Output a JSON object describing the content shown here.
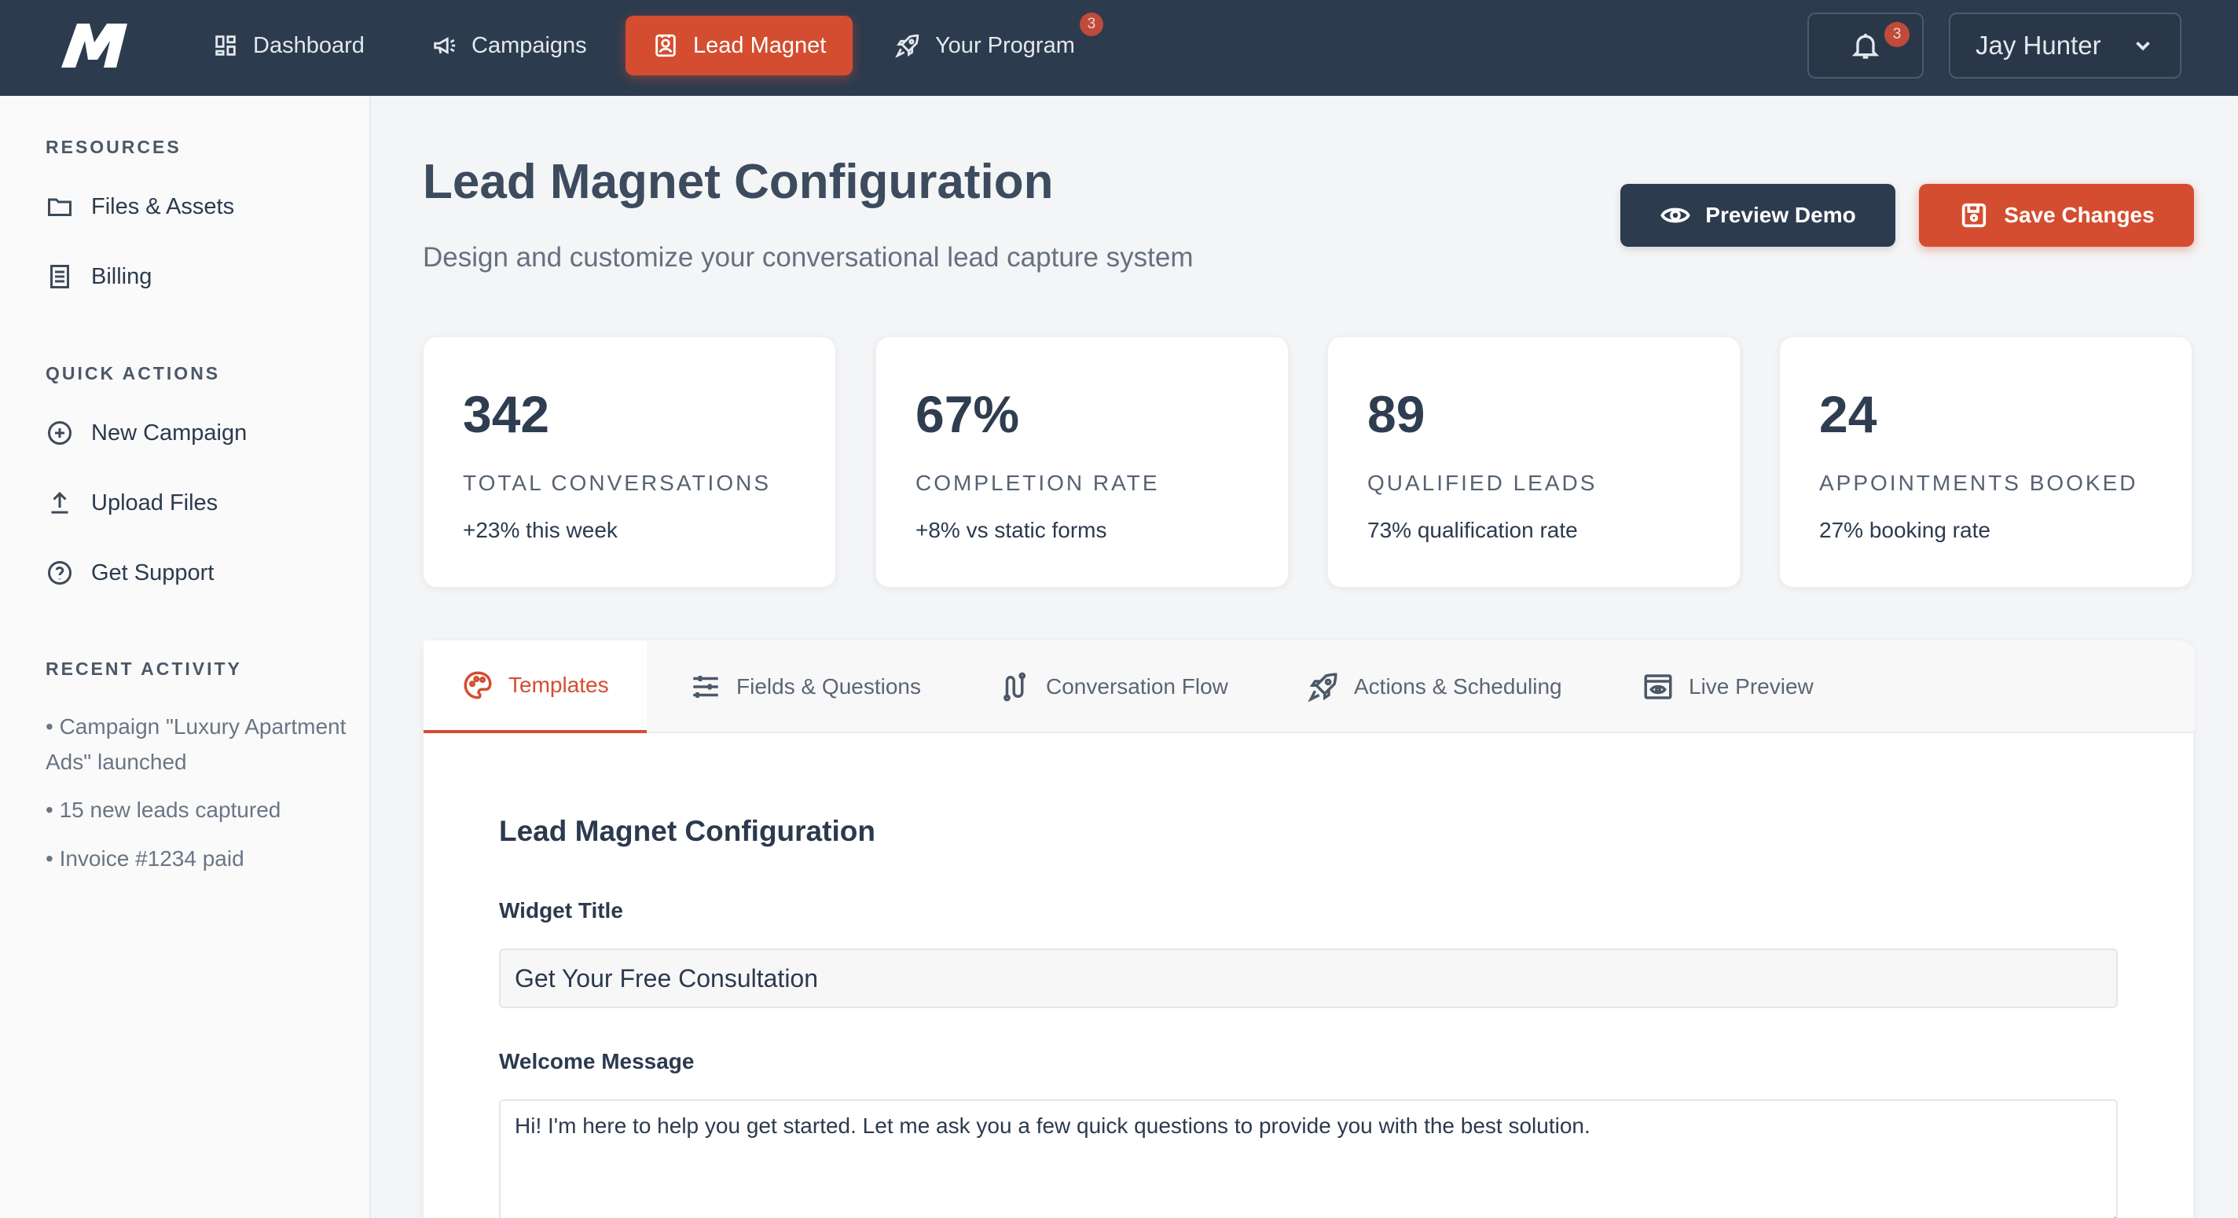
{
  "topbar": {
    "nav": [
      {
        "label": "Dashboard",
        "icon": "dashboard-icon"
      },
      {
        "label": "Campaigns",
        "icon": "megaphone-icon"
      },
      {
        "label": "Lead Magnet",
        "icon": "contact-card-icon",
        "active": true
      },
      {
        "label": "Your Program",
        "icon": "rocket-icon",
        "badge": "3"
      }
    ],
    "notifications_badge": "3",
    "user_name": "Jay Hunter"
  },
  "sidebar": {
    "resources_heading": "RESOURCES",
    "resources": [
      {
        "label": "Files & Assets",
        "icon": "folder-icon"
      },
      {
        "label": "Billing",
        "icon": "document-icon"
      }
    ],
    "quick_actions_heading": "QUICK ACTIONS",
    "quick_actions": [
      {
        "label": "New Campaign",
        "icon": "plus-circle-icon"
      },
      {
        "label": "Upload Files",
        "icon": "upload-icon"
      },
      {
        "label": "Get Support",
        "icon": "help-circle-icon"
      }
    ],
    "recent_activity_heading": "RECENT ACTIVITY",
    "recent_activity": [
      "• Campaign \"Luxury Apartment Ads\" launched",
      "• 15 new leads captured",
      "• Invoice #1234 paid"
    ]
  },
  "main": {
    "title": "Lead Magnet Configuration",
    "subtitle": "Design and customize your conversational lead capture system",
    "preview_button": "Preview Demo",
    "save_button": "Save Changes",
    "stats": [
      {
        "value": "342",
        "label": "TOTAL CONVERSATIONS",
        "note": "+23% this week"
      },
      {
        "value": "67%",
        "label": "COMPLETION RATE",
        "note": "+8% vs static forms"
      },
      {
        "value": "89",
        "label": "QUALIFIED LEADS",
        "note": "73% qualification rate"
      },
      {
        "value": "24",
        "label": "APPOINTMENTS BOOKED",
        "note": "27% booking rate"
      }
    ],
    "tabs": [
      {
        "label": "Templates",
        "icon": "palette-icon",
        "active": true
      },
      {
        "label": "Fields & Questions",
        "icon": "sliders-icon"
      },
      {
        "label": "Conversation Flow",
        "icon": "route-icon"
      },
      {
        "label": "Actions & Scheduling",
        "icon": "rocket-icon"
      },
      {
        "label": "Live Preview",
        "icon": "eye-window-icon"
      }
    ],
    "form": {
      "section_title": "Lead Magnet Configuration",
      "widget_title_label": "Widget Title",
      "widget_title_value": "Get Your Free Consultation",
      "welcome_label": "Welcome Message",
      "welcome_value": "Hi! I'm here to help you get started. Let me ask you a few quick questions to provide you with the best solution."
    }
  },
  "colors": {
    "accent": "#d44d30",
    "navy": "#2d3b4e"
  }
}
